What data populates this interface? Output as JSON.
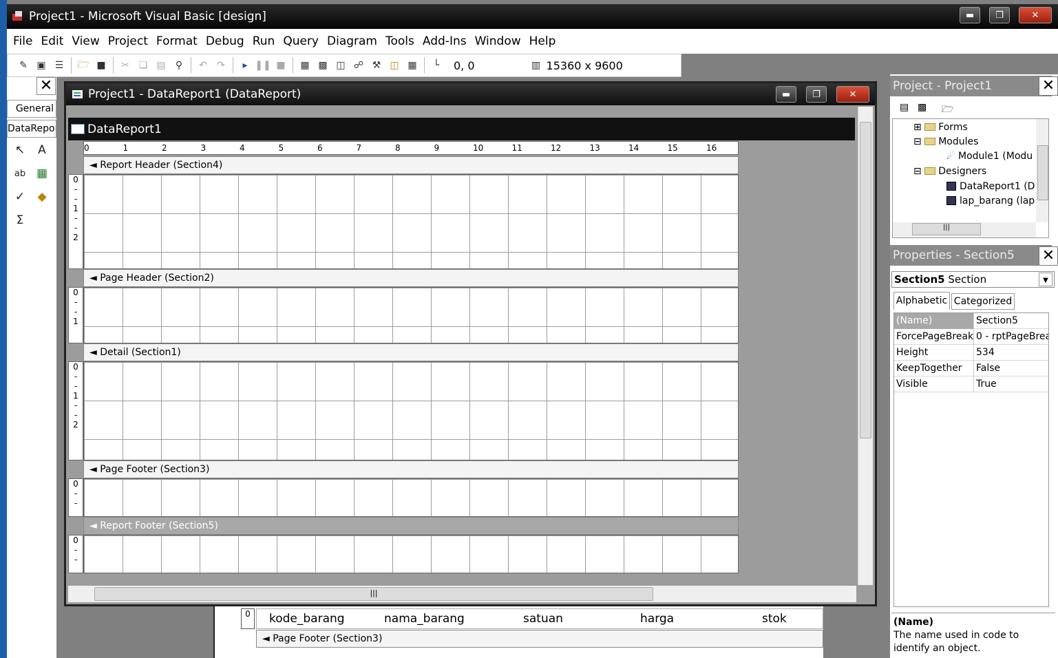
{
  "window": {
    "title": "Project1 - Microsoft Visual Basic [design]"
  },
  "menu": [
    "File",
    "Edit",
    "View",
    "Project",
    "Format",
    "Debug",
    "Run",
    "Query",
    "Diagram",
    "Tools",
    "Add-Ins",
    "Window",
    "Help"
  ],
  "toolbar": {
    "position": "0, 0",
    "size": "15360 x 9600"
  },
  "toolbox": {
    "tabs": [
      "General",
      "DataRepor"
    ]
  },
  "child": {
    "title": "Project1 - DataReport1 (DataReport)",
    "report_name": "DataReport1"
  },
  "ruler": [
    "0",
    "1",
    "2",
    "3",
    "4",
    "5",
    "6",
    "7",
    "8",
    "9",
    "10",
    "11",
    "12",
    "13",
    "14",
    "15",
    "16"
  ],
  "sections": {
    "report_header": "Report Header  (Section4)",
    "page_header": "Page Header  (Section2)",
    "detail": "Detail  (Section1)",
    "page_footer": "Page Footer  (Section3)",
    "report_footer": "Report Footer  (Section5)"
  },
  "vruler": {
    "a": "0",
    "b": "1",
    "c": "2"
  },
  "behind": {
    "fields": [
      "kode_barang",
      "nama_barang",
      "satuan",
      "harga",
      "stok"
    ],
    "band": "Page Footer  (Section3)",
    "zero": "0"
  },
  "project": {
    "title": "Project - Project1",
    "tree": [
      "Forms",
      "Modules",
      "Module1 (Modu",
      "Designers",
      "DataReport1 (D",
      "lap_barang (lap"
    ]
  },
  "properties": {
    "title": "Properties - Section5",
    "object": "Section5",
    "object_type": "Section",
    "tabs": [
      "Alphabetic",
      "Categorized"
    ],
    "rows": [
      {
        "k": "(Name)",
        "v": "Section5"
      },
      {
        "k": "ForcePageBreak",
        "v": "0 - rptPageBrea"
      },
      {
        "k": "Height",
        "v": "534"
      },
      {
        "k": "KeepTogether",
        "v": "False"
      },
      {
        "k": "Visible",
        "v": "True"
      }
    ],
    "desc_title": "(Name)",
    "desc": "The name used in code to identify an object."
  }
}
